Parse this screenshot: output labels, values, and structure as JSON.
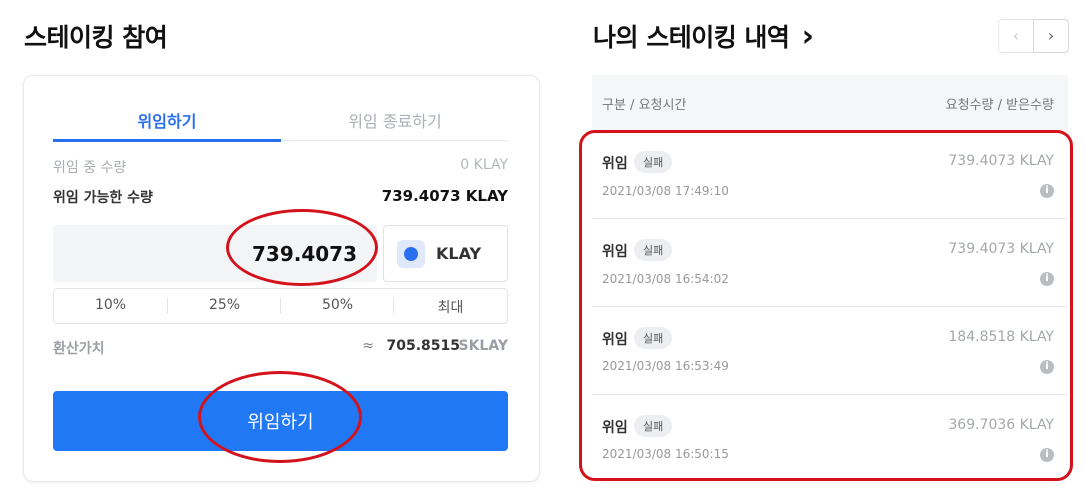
{
  "left": {
    "title": "스테이킹 참여",
    "tabs": [
      {
        "label": "위임하기",
        "active": true
      },
      {
        "label": "위임 종료하기",
        "active": false
      }
    ],
    "delegating_label": "위임 중 수량",
    "delegating_value": "0 KLAY",
    "available_label": "위임 가능한 수량",
    "available_value": "739.4073 KLAY",
    "amount_input_value": "739.4073",
    "token": {
      "label": "KLAY",
      "icon": "klaytn-icon"
    },
    "percent_buttons": [
      "10%",
      "25%",
      "50%",
      "최대"
    ],
    "conversion_label": "환산가치",
    "conversion_approx": "≈",
    "conversion_value": "705.8515",
    "conversion_unit": "SKLAY",
    "delegate_button_label": "위임하기"
  },
  "right": {
    "title": "나의 스테이킹 내역",
    "title_arrow": "›",
    "pager": {
      "prev": "‹",
      "next": "›"
    },
    "header_left": "구분 / 요청시간",
    "header_right": "요청수량 / 받은수량",
    "rows": [
      {
        "type": "위임",
        "status": "실패",
        "time": "2021/03/08 17:49:10",
        "amount": "739.4073 KLAY"
      },
      {
        "type": "위임",
        "status": "실패",
        "time": "2021/03/08 16:54:02",
        "amount": "739.4073 KLAY"
      },
      {
        "type": "위임",
        "status": "실패",
        "time": "2021/03/08 16:53:49",
        "amount": "184.8518 KLAY"
      },
      {
        "type": "위임",
        "status": "실패",
        "time": "2021/03/08 16:50:15",
        "amount": "369.7036 KLAY"
      }
    ]
  },
  "colors": {
    "accent": "#2a6ff0",
    "button": "#2178f5",
    "annotation": "#d4121c"
  }
}
